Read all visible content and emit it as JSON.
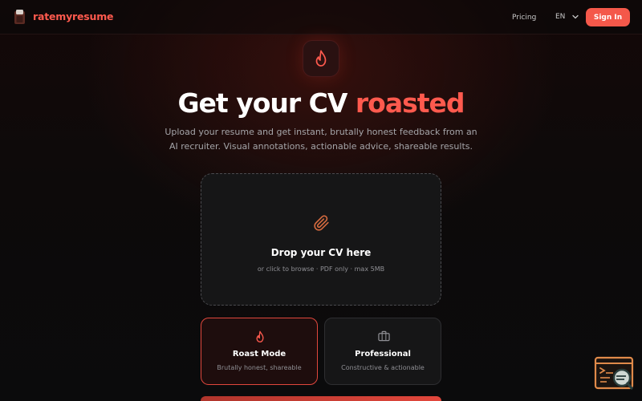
{
  "header": {
    "brand_name": "ratemyresume",
    "nav_pricing": "Pricing",
    "language": "EN",
    "signin_label": "Sign In"
  },
  "hero": {
    "title_main": "Get your CV ",
    "title_accent": "roasted",
    "subtitle": "Upload your resume and get instant, brutally honest feedback from an AI recruiter. Visual annotations, actionable advice, shareable results."
  },
  "dropzone": {
    "title": "Drop your CV here",
    "hint": "or click to browse · PDF only · max 5MB"
  },
  "modes": [
    {
      "title": "Roast Mode",
      "description": "Brutally honest, shareable",
      "icon": "flame-icon",
      "selected": true
    },
    {
      "title": "Professional",
      "description": "Constructive & actionable",
      "icon": "briefcase-icon",
      "selected": false
    }
  ],
  "colors": {
    "accent": "#ff5a4e",
    "button": "#f4584a",
    "background": "#0d0a0a"
  }
}
